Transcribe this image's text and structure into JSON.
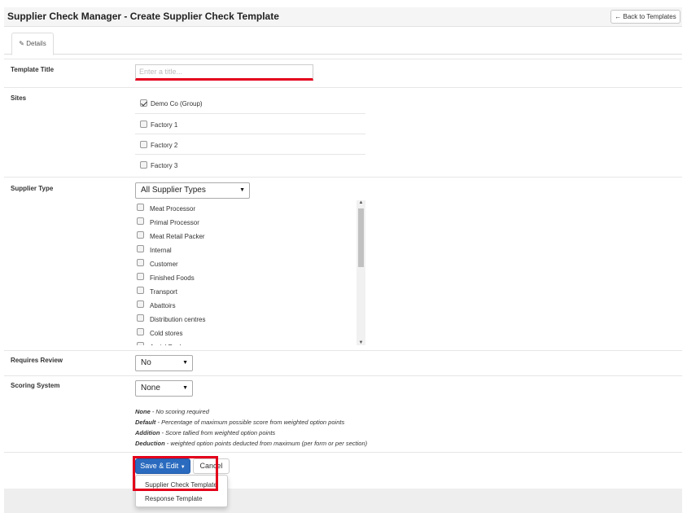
{
  "header": {
    "title": "Supplier Check Manager - Create Supplier Check Template",
    "back_button": "Back to Templates"
  },
  "tabs": {
    "details": "Details"
  },
  "form": {
    "template_title": {
      "label": "Template Title",
      "placeholder": "Enter a title..."
    },
    "sites": {
      "label": "Sites",
      "items": [
        {
          "label": "Demo Co (Group)",
          "checked": true
        },
        {
          "label": "Factory 1",
          "checked": false
        },
        {
          "label": "Factory 2",
          "checked": false
        },
        {
          "label": "Factory 3",
          "checked": false
        }
      ]
    },
    "supplier_type": {
      "label": "Supplier Type",
      "selected": "All Supplier Types",
      "items": [
        "Meat Processor",
        "Primal Processor",
        "Meat Retail Packer",
        "Internal",
        "Customer",
        "Finished Foods",
        "Transport",
        "Abattoirs",
        "Distribution centres",
        "Cold stores",
        "Aerial Packer"
      ]
    },
    "requires_review": {
      "label": "Requires Review",
      "selected": "No"
    },
    "scoring_system": {
      "label": "Scoring System",
      "selected": "None",
      "help": [
        {
          "term": "None",
          "desc": " - No scoring required"
        },
        {
          "term": "Default",
          "desc": " - Percentage of maximum possible score from weighted option points"
        },
        {
          "term": "Addition",
          "desc": " - Score tallied from weighted option points"
        },
        {
          "term": "Deduction",
          "desc": " - weighted option points deducted from maximum (per form or per section)"
        }
      ]
    }
  },
  "actions": {
    "save_edit": "Save & Edit",
    "cancel": "Cancel",
    "menu": [
      "Supplier Check Template",
      "Response Template"
    ]
  },
  "colors": {
    "primary": "#2a6bbf",
    "highlight": "#e3001b"
  }
}
